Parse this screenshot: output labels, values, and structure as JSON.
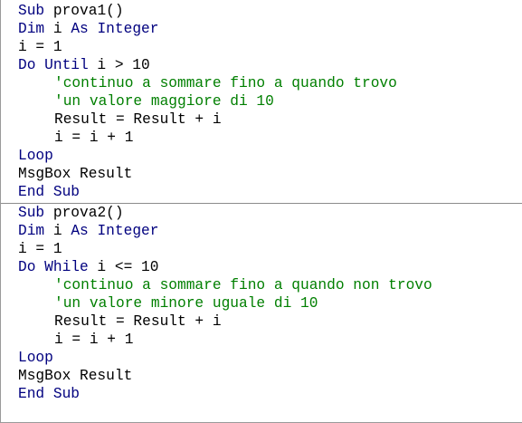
{
  "colors": {
    "keyword": "#00007f",
    "comment": "#007f00",
    "text": "#000000",
    "separator": "#8c8c8c"
  },
  "procedures": [
    {
      "lines": [
        {
          "kw": "Sub",
          "rest": " prova1()"
        },
        {
          "kw": "Dim",
          "rest": " i ",
          "kw2": "As",
          "rest2": " ",
          "kw3": "Integer"
        },
        {
          "text": "i = 1"
        },
        {
          "kw": "Do Until",
          "rest": " i > 10"
        },
        {
          "comment": "'continuo a sommare fino a quando trovo"
        },
        {
          "comment": "'un valore maggiore di 10"
        },
        {
          "text": "Result = Result + i"
        },
        {
          "text": "i = i + 1"
        },
        {
          "kw": "Loop"
        },
        {
          "text": "MsgBox Result"
        },
        {
          "kw": "End Sub"
        }
      ]
    },
    {
      "lines": [
        {
          "kw": "Sub",
          "rest": " prova2()"
        },
        {
          "kw": "Dim",
          "rest": " i ",
          "kw2": "As",
          "rest2": " ",
          "kw3": "Integer"
        },
        {
          "text": "i = 1"
        },
        {
          "kw": "Do While",
          "rest": " i <= 10"
        },
        {
          "comment": "'continuo a sommare fino a quando non trovo"
        },
        {
          "comment": "'un valore minore uguale di 10"
        },
        {
          "text": "Result = Result + i"
        },
        {
          "text": "i = i + 1"
        },
        {
          "kw": "Loop"
        },
        {
          "text": "MsgBox Result"
        },
        {
          "kw": "End Sub"
        }
      ]
    }
  ]
}
